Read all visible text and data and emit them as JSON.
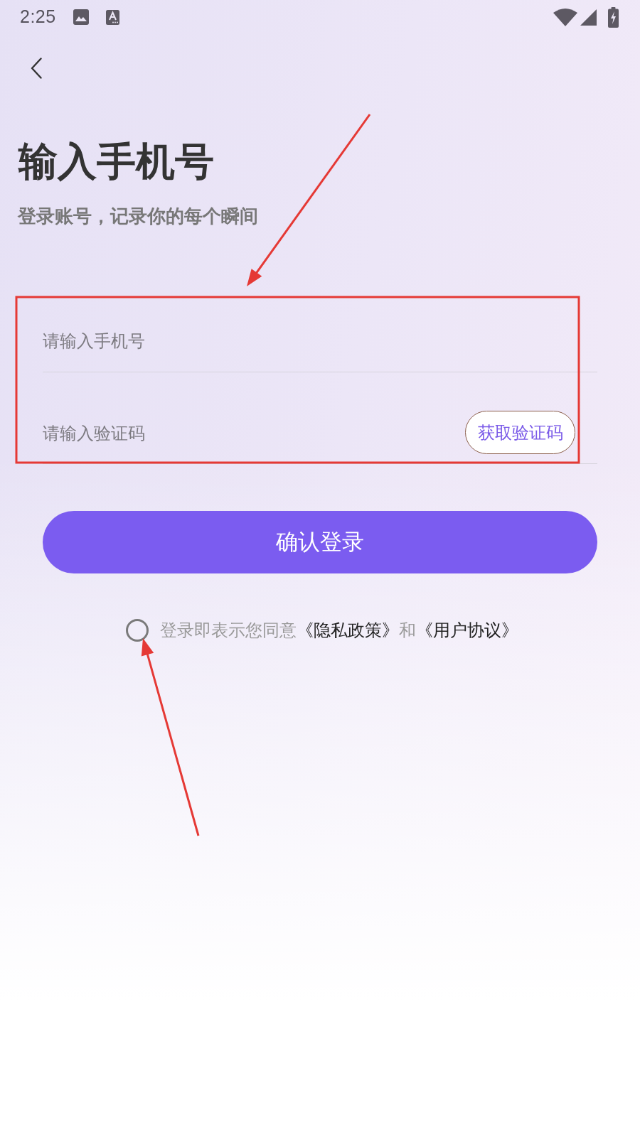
{
  "status_bar": {
    "time": "2:25"
  },
  "header": {
    "title": "输入手机号",
    "subtitle": "登录账号，记录你的每个瞬间"
  },
  "form": {
    "phone_field": {
      "placeholder": "请输入手机号"
    },
    "code_field": {
      "placeholder": "请输入验证码"
    },
    "get_code_button": "获取验证码",
    "submit_button": "确认登录"
  },
  "agreement": {
    "checked": false,
    "parts": [
      {
        "kind": "plain",
        "text": "登录即表示您同意"
      },
      {
        "kind": "link",
        "text": "《隐私政策》"
      },
      {
        "kind": "plain",
        "text": "和"
      },
      {
        "kind": "link",
        "text": "《用户协议》"
      }
    ]
  },
  "annotations": [
    {
      "kind": "arrow"
    },
    {
      "kind": "box"
    },
    {
      "kind": "arrow"
    }
  ]
}
